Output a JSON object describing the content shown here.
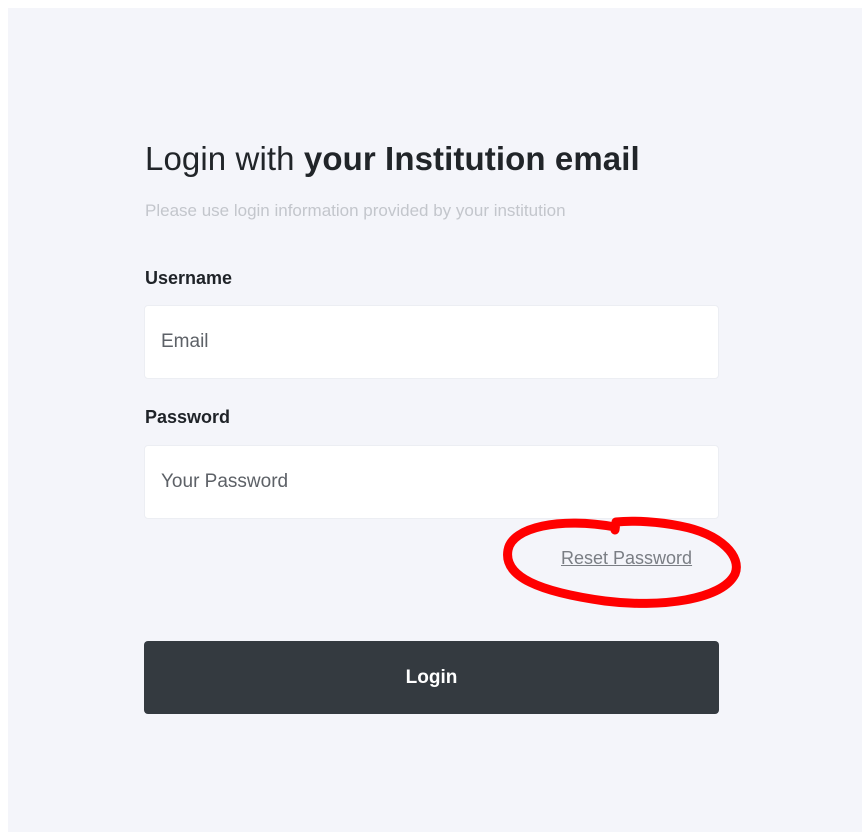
{
  "login_form": {
    "title_regular": "Login with ",
    "title_bold": "your Institution email",
    "subtitle": "Please use login information provided by your institution",
    "username_label": "Username",
    "username_placeholder": "Email",
    "username_value": "",
    "password_label": "Password",
    "password_placeholder": "Your Password",
    "password_value": "",
    "reset_password_link": "Reset Password",
    "login_button": "Login"
  },
  "annotation": {
    "shape": "hand-drawn circle around Reset Password link",
    "color": "#ff0000"
  },
  "colors": {
    "page_background": "#f4f5fa",
    "button_background": "#343a40",
    "subtitle_text": "#c3c6cc",
    "link_text": "#7a7e84"
  }
}
